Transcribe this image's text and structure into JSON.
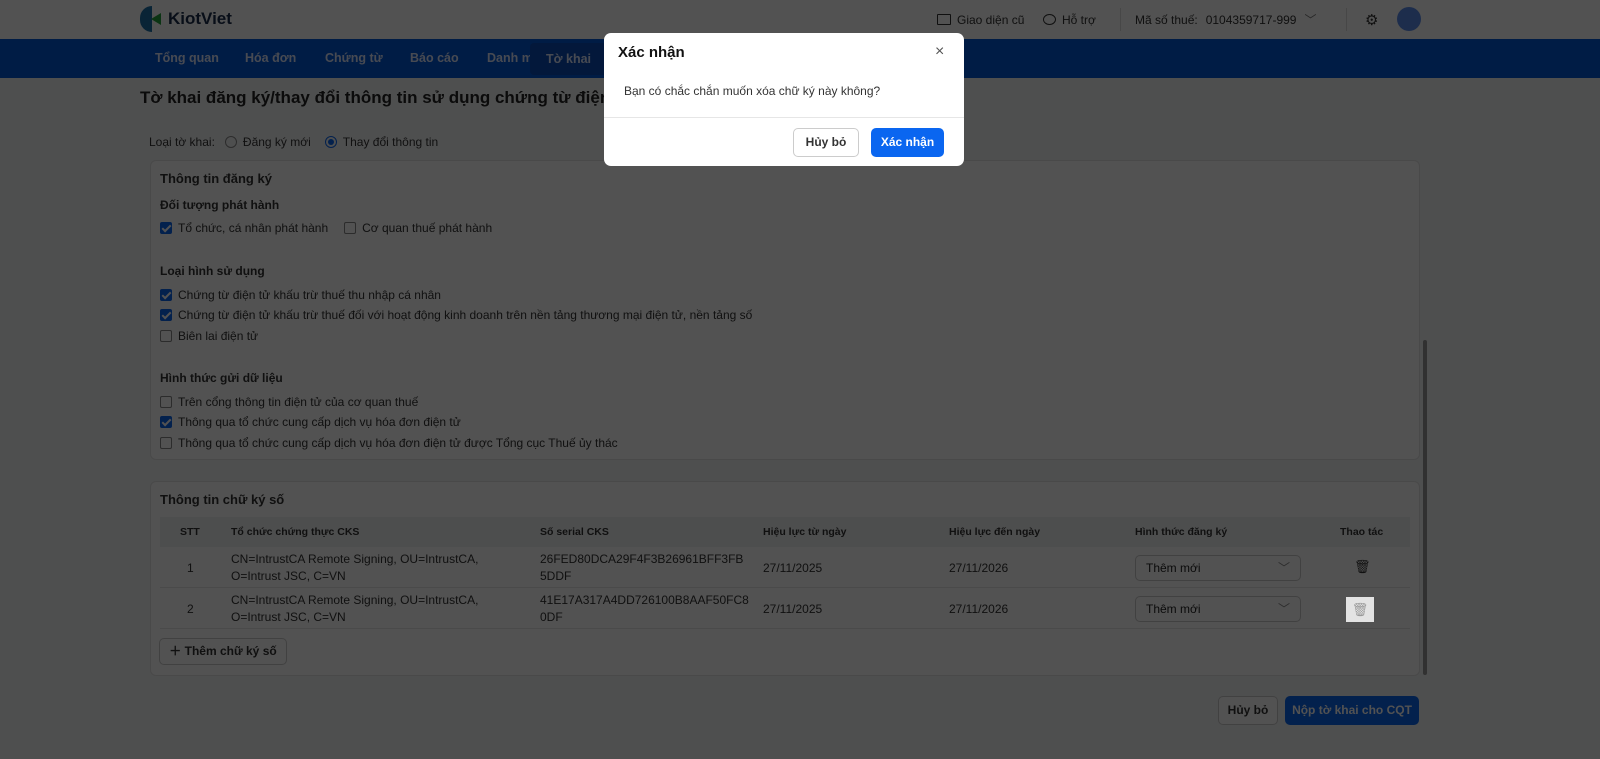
{
  "header": {
    "brand": "KiotViet",
    "old_ui": "Giao diện cũ",
    "support": "Hỗ trợ",
    "tax_label": "Mã số thuế:",
    "tax_code": "0104359717-999"
  },
  "nav": {
    "items": [
      {
        "label": "Tổng quan"
      },
      {
        "label": "Hóa đơn"
      },
      {
        "label": "Chứng từ"
      },
      {
        "label": "Báo cáo"
      },
      {
        "label": "Danh mục"
      },
      {
        "label": "Tờ khai"
      }
    ]
  },
  "page": {
    "title": "Tờ khai đăng ký/thay đổi thông tin sử dụng chứng từ điện tử"
  },
  "form": {
    "type_label": "Loại tờ khai:",
    "type_options": [
      {
        "label": "Đăng ký mới",
        "selected": false
      },
      {
        "label": "Thay đổi thông tin",
        "selected": true
      }
    ],
    "reg_title": "Thông tin đăng ký",
    "issuer_title": "Đối tượng phát hành",
    "issuer_options": [
      {
        "label": "Tổ chức, cá nhân phát hành",
        "checked": true
      },
      {
        "label": "Cơ quan thuế phát hành",
        "checked": false
      }
    ],
    "usage_title": "Loại hình sử dụng",
    "usage_options": [
      {
        "label": "Chứng từ điện tử khấu trừ thuế thu nhập cá nhân",
        "checked": true
      },
      {
        "label": "Chứng từ điện tử khấu trừ thuế đối với hoạt động kinh doanh trên nền tảng thương mại điện tử, nền tảng số",
        "checked": true
      },
      {
        "label": "Biên lai điện tử",
        "checked": false
      }
    ],
    "send_title": "Hình thức gửi dữ liệu",
    "send_options": [
      {
        "label": "Trên cổng thông tin điện tử của cơ quan thuế",
        "checked": false
      },
      {
        "label": "Thông qua tổ chức cung cấp dịch vụ hóa đơn điện tử",
        "checked": true
      },
      {
        "label": "Thông qua tổ chức cung cấp dịch vụ hóa đơn điện tử được Tổng cục Thuế ủy thác",
        "checked": false
      }
    ]
  },
  "signatures": {
    "title": "Thông tin chữ ký số",
    "columns": [
      "STT",
      "Tổ chức chứng thực CKS",
      "Số serial CKS",
      "Hiệu lực từ ngày",
      "Hiệu lực đến ngày",
      "Hình thức đăng ký",
      "Thao tác"
    ],
    "rows": [
      {
        "stt": "1",
        "org1": "CN=IntrustCA Remote Signing, OU=IntrustCA,",
        "org2": "O=Intrust JSC, C=VN",
        "serial1": "26FED80DCA29F4F3B26961BFF3FB",
        "serial2": "5DDF",
        "from": "27/11/2025",
        "to": "27/11/2026",
        "reg": "Thêm mới"
      },
      {
        "stt": "2",
        "org1": "CN=IntrustCA Remote Signing, OU=IntrustCA,",
        "org2": "O=Intrust JSC, C=VN",
        "serial1": "41E17A317A4DD726100B8AAF50FC8",
        "serial2": "0DF",
        "from": "27/11/2025",
        "to": "27/11/2026",
        "reg": "Thêm mới"
      }
    ],
    "add_label": "Thêm chữ ký số"
  },
  "footer": {
    "cancel": "Hủy bỏ",
    "submit": "Nộp tờ khai cho CQT"
  },
  "modal": {
    "title": "Xác nhận",
    "message": "Bạn có chắc chắn muốn xóa chữ ký này không?",
    "cancel": "Hủy bỏ",
    "confirm": "Xác nhận"
  },
  "colors": {
    "primary": "#0a66f0",
    "nav": "#0057d9"
  }
}
